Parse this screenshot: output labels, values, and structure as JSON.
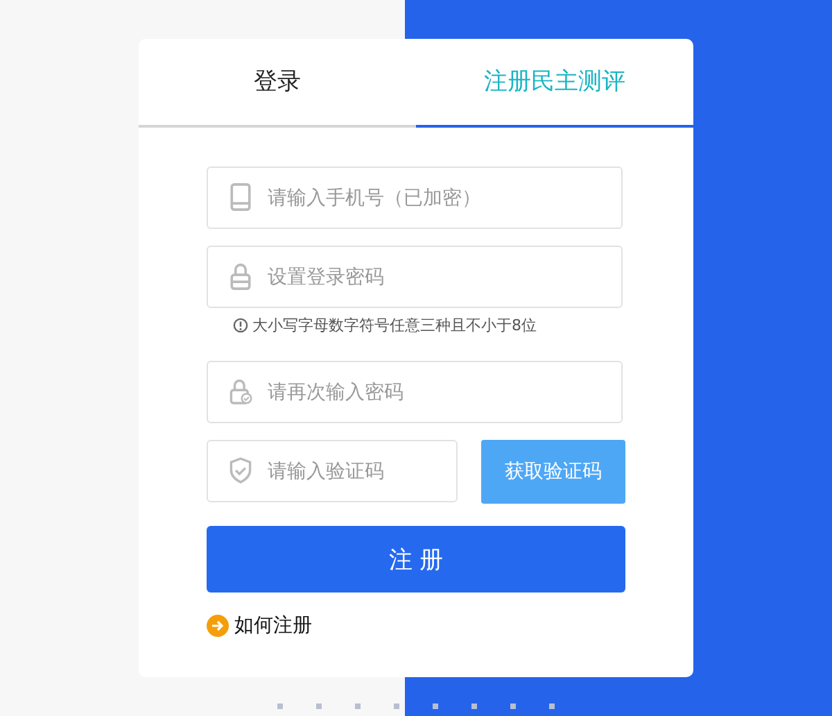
{
  "tabs": [
    {
      "label": "登录",
      "selected": false
    },
    {
      "label": "注册民主测评",
      "selected": true
    }
  ],
  "fields": [
    {
      "kind": "phone",
      "placeholder": "请输入手机号（已加密）"
    },
    {
      "kind": "lock",
      "placeholder": "设置登录密码",
      "hint": "大小写字母数字符号任意三种且不小于8位"
    },
    {
      "kind": "lock-check",
      "placeholder": "请再次输入密码"
    },
    {
      "kind": "shield",
      "placeholder": "请输入验证码",
      "button": "获取验证码"
    }
  ],
  "submit": "注 册",
  "help_link": "如何注册"
}
